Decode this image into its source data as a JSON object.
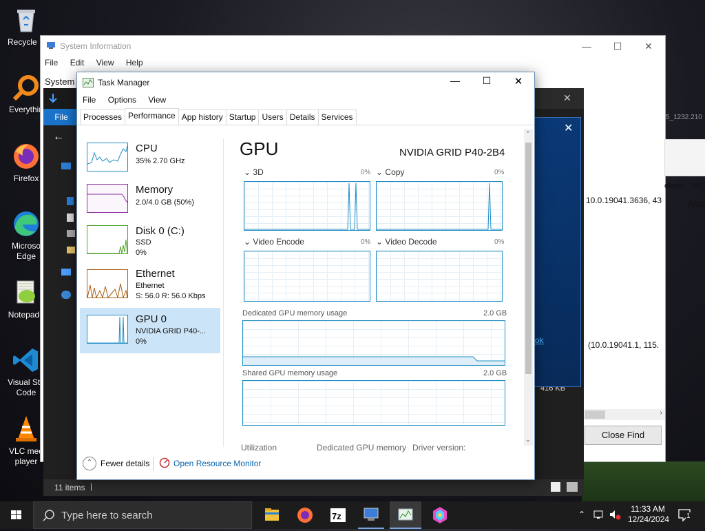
{
  "desktop": {
    "icons": [
      {
        "label": "Recycle Bin",
        "shown": "Recycle B"
      },
      {
        "label": "Everything",
        "shown": "Everythin"
      },
      {
        "label": "Firefox",
        "shown": "Firefox"
      },
      {
        "label": "Microsoft Edge",
        "shown": "Microso Edge"
      },
      {
        "label": "Notepad++",
        "shown": "Notepad+"
      },
      {
        "label": "Visual Studio Code",
        "shown": "Visual Stu Code"
      },
      {
        "label": "VLC media player",
        "shown": "VLC med player"
      }
    ]
  },
  "system_info": {
    "title": "System Information",
    "menu": [
      "File",
      "Edit",
      "View",
      "Help"
    ],
    "left_label": "System",
    "right_items": [
      "5_1232.210",
      "eloper_265_",
      "Acce",
      "10.0.19041.3636, 43",
      "(10.0.19041.1, 115.",
      "416 KB"
    ],
    "close_find": "Close Find"
  },
  "explorer": {
    "file_tab": "File",
    "status_items": "11 items",
    "link_text": "ok"
  },
  "task_manager": {
    "title": "Task Manager",
    "menu": [
      "File",
      "Options",
      "View"
    ],
    "tabs": [
      "Processes",
      "Performance",
      "App history",
      "Startup",
      "Users",
      "Details",
      "Services"
    ],
    "active_tab": "Performance",
    "sidebar": [
      {
        "name": "CPU",
        "line1": "35%  2.70 GHz",
        "line2": "",
        "color": "#1e8cc4"
      },
      {
        "name": "Memory",
        "line1": "2.0/4.0 GB (50%)",
        "line2": "",
        "color": "#8b2e9e"
      },
      {
        "name": "Disk 0 (C:)",
        "line1": "SSD",
        "line2": "0%",
        "color": "#4da32a"
      },
      {
        "name": "Ethernet",
        "line1": "Ethernet",
        "line2": "S: 56.0  R: 56.0 Kbps",
        "color": "#a75d13"
      },
      {
        "name": "GPU 0",
        "line1": "NVIDIA GRID P40-...",
        "line2": "0%",
        "color": "#1e8cc4"
      }
    ],
    "gpu": {
      "heading": "GPU",
      "model": "NVIDIA GRID P40-2B4",
      "engines": [
        {
          "name": "3D",
          "pct": "0%"
        },
        {
          "name": "Copy",
          "pct": "0%"
        },
        {
          "name": "Video Encode",
          "pct": "0%"
        },
        {
          "name": "Video Decode",
          "pct": "0%"
        }
      ],
      "dedicated_label": "Dedicated GPU memory usage",
      "dedicated_max": "2.0 GB",
      "shared_label": "Shared GPU memory usage",
      "shared_max": "2.0 GB",
      "bottom": [
        "Utilization",
        "Dedicated GPU memory",
        "Driver version:"
      ]
    },
    "fewer_details": "Fewer details",
    "open_monitor": "Open Resource Monitor"
  },
  "taskbar": {
    "search_placeholder": "Type here to search",
    "time": "11:33 AM",
    "date": "12/24/2024",
    "notification_count": "1"
  }
}
